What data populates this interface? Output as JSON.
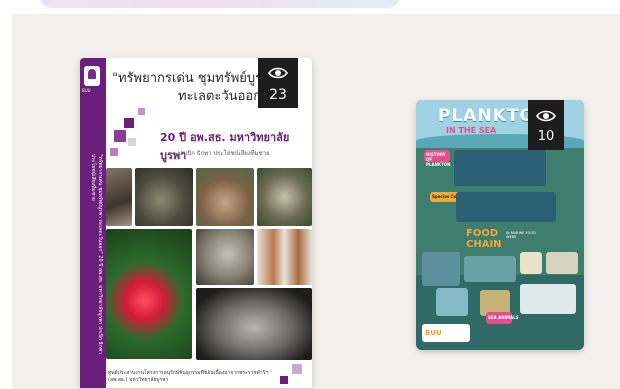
{
  "books": [
    {
      "title_line1": "\"ทรัพยากรเด่น ชุมทรัพย์บูรพา",
      "title_line2": "ทะเลตะวันออก",
      "title_tail": "ะ",
      "subtitle": "20 ปี อพ.สธ. มหาวิทยาลัยบูรพา",
      "authors": "ปกเปิก ธิกพา ประโยชน์เสียงที่มชาย",
      "spine_text": "\"ทรัพยากรเด่น ชุมทรัพย์บูรพา ทะเลตะวันออก\" 20 ปี อพ.สธ. มหาวิทยาลัยบูรพา ปกเปิก ธิกพา ประโยชน์เสียงที่มชาย",
      "logo_text": "BUU",
      "footer_line1": "ศูนย์ประสานงานโครงการอนุรักษ์พันธุกรรมพืชอันเนื่องมาจากพระราชดำริฯ",
      "footer_line2": "(อพ.สธ.) มหาวิทยาลัยบูรพา",
      "views": "23",
      "views_icon": "eye-icon"
    },
    {
      "title": "PLANKTO",
      "subtitle": "IN THE SEA",
      "history_label": "HISTORY OF PLANKTON",
      "species_label": "Species Composition",
      "food_chain_line1": "FOOD",
      "food_chain_line2": "CHAIN",
      "food_chain_note": "IN MARINE FOOD WEBS",
      "sea_animals_label": "SEA ANIMALS",
      "logo_text": "BUU",
      "views": "10",
      "views_icon": "eye-icon"
    }
  ],
  "colors": {
    "shelf": "#f2efed",
    "book1_purple": "#6b1f7a",
    "poster_teal": "#3f7d6e",
    "badge": "#1d1d1d"
  }
}
